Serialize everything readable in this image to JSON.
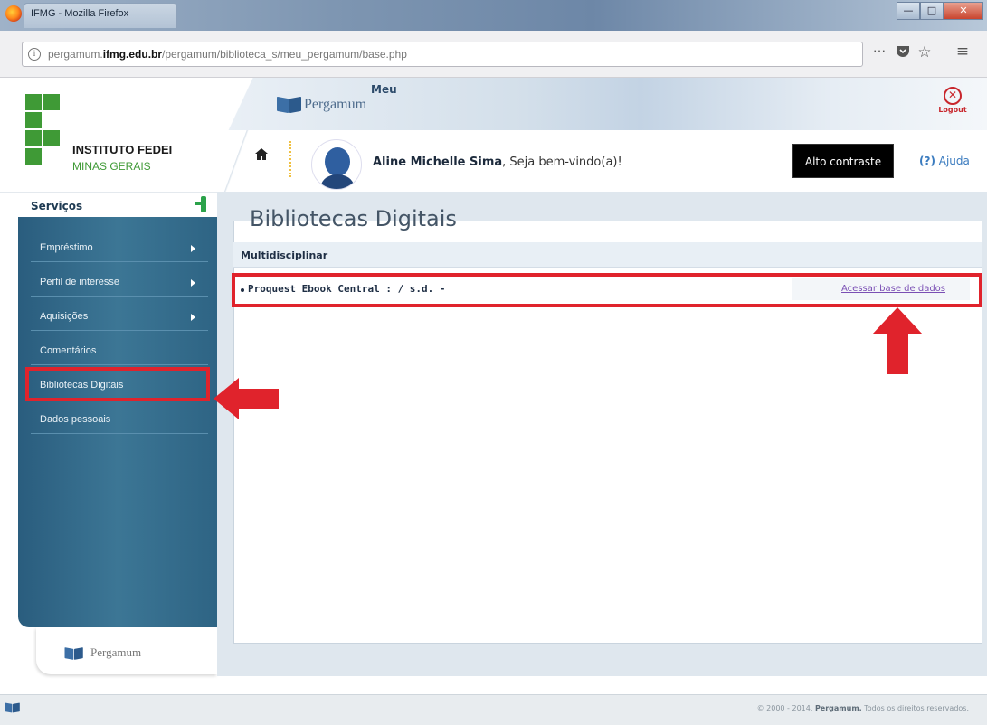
{
  "window": {
    "title": "IFMG - Mozilla Firefox",
    "controls": [
      "minimize",
      "maximize",
      "close"
    ]
  },
  "browser": {
    "url_prefix": "pergamum.",
    "url_domain": "ifmg.edu.br",
    "url_path": "/pergamum/biblioteca_s/meu_pergamum/base.php",
    "menu_icon_label": "···",
    "icons": [
      "info-icon",
      "pocket-icon",
      "bookmark-star-icon",
      "hamburger-menu-icon"
    ]
  },
  "header": {
    "institution_line1": "INSTITUTO FEDEI",
    "institution_line2": "MINAS GERAIS",
    "brand_meu": "Meu",
    "brand_pergamum": "Pergamum",
    "logout_label": "Logout",
    "user_name": "Aline Michelle Sima",
    "welcome_suffix": ", Seja bem-vindo(a)!",
    "alto_contraste": "Alto contraste",
    "help_mark": "(?)",
    "help_label": "Ajuda"
  },
  "sidebar": {
    "title": "Serviços",
    "items": [
      {
        "label": "Empréstimo",
        "has_arrow": true
      },
      {
        "label": "Perfil de interesse",
        "has_arrow": true
      },
      {
        "label": "Aquisições",
        "has_arrow": true
      },
      {
        "label": "Comentários",
        "has_arrow": false
      },
      {
        "label": "Bibliotecas Digitais",
        "has_arrow": false
      },
      {
        "label": "Dados pessoais",
        "has_arrow": false
      }
    ],
    "footer_brand": "Pergamum"
  },
  "main": {
    "page_title": "Bibliotecas Digitais",
    "section": "Multidisciplinar",
    "entries": [
      {
        "name": "Proquest Ebook Central : / s.d. -",
        "link": "Acessar base de dados"
      }
    ]
  },
  "footer": {
    "copyright_prefix": "© 2000 - 2014.",
    "brand": "Pergamum.",
    "copyright_suffix": "Todos os direitos reservados."
  },
  "colors": {
    "accent_green": "#3f9a36",
    "accent_red": "#c8262c",
    "sidebar_blue": "#2f6a8c",
    "annotation_red": "#e0232c"
  }
}
